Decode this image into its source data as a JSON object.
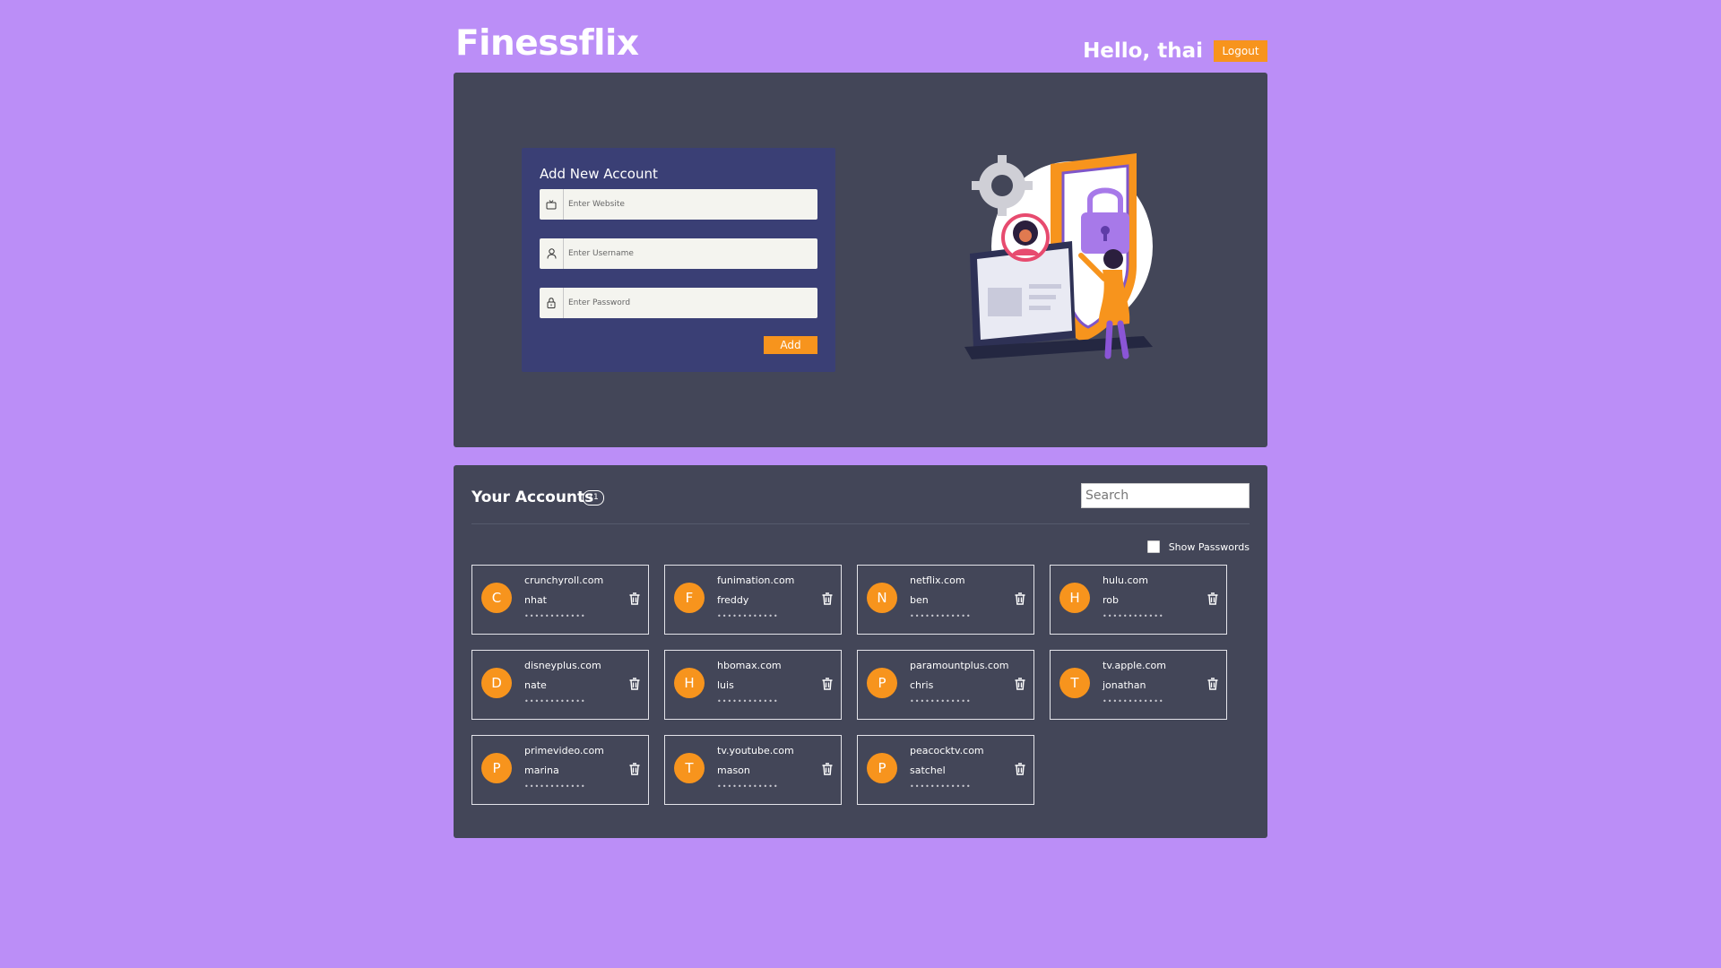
{
  "header": {
    "logo": "Finessflix",
    "greeting": "Hello, thai",
    "logout_label": "Logout"
  },
  "form": {
    "title": "Add New Account",
    "website_placeholder": "Enter Website",
    "username_placeholder": "Enter Username",
    "password_placeholder": "Enter Password",
    "add_label": "Add",
    "icons": [
      "tv-icon",
      "user-icon",
      "lock-icon"
    ]
  },
  "accounts_section": {
    "title": "Your Accounts",
    "count": "11",
    "search_placeholder": "Search",
    "show_passwords_label": "Show Passwords"
  },
  "accounts": [
    {
      "initial": "C",
      "website": "crunchyroll.com",
      "username": "nhat",
      "password_mask": "••••••••••••"
    },
    {
      "initial": "F",
      "website": "funimation.com",
      "username": "freddy",
      "password_mask": "••••••••••••"
    },
    {
      "initial": "N",
      "website": "netflix.com",
      "username": "ben",
      "password_mask": "••••••••••••"
    },
    {
      "initial": "H",
      "website": "hulu.com",
      "username": "rob",
      "password_mask": "••••••••••••"
    },
    {
      "initial": "D",
      "website": "disneyplus.com",
      "username": "nate",
      "password_mask": "••••••••••••"
    },
    {
      "initial": "H",
      "website": "hbomax.com",
      "username": "luis",
      "password_mask": "••••••••••••"
    },
    {
      "initial": "P",
      "website": "paramountplus.com",
      "username": "chris",
      "password_mask": "••••••••••••"
    },
    {
      "initial": "T",
      "website": "tv.apple.com",
      "username": "jonathan",
      "password_mask": "••••••••••••"
    },
    {
      "initial": "P",
      "website": "primevideo.com",
      "username": "marina",
      "password_mask": "••••••••••••"
    },
    {
      "initial": "T",
      "website": "tv.youtube.com",
      "username": "mason",
      "password_mask": "••••••••••••"
    },
    {
      "initial": "P",
      "website": "peacocktv.com",
      "username": "satchel",
      "password_mask": "••••••••••••"
    }
  ],
  "colors": {
    "background": "#bb8ef7",
    "panel": "#434658",
    "form_card": "#3a3f75",
    "accent": "#f7941d"
  }
}
